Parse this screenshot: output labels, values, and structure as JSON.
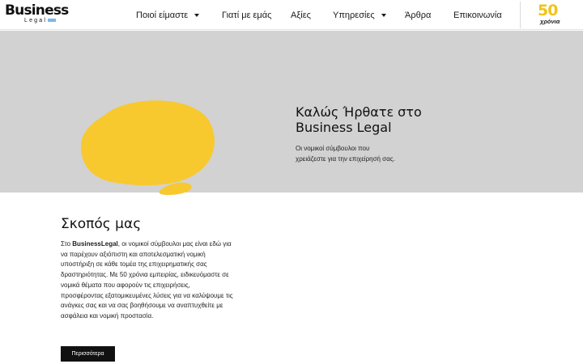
{
  "brand": {
    "logo_word": "Business",
    "logo_sub": "Legal"
  },
  "nav": {
    "items": [
      {
        "label": "Ποιοί είμαστε",
        "has_dropdown": true
      },
      {
        "label": "Γιατί με εμάς",
        "has_dropdown": false
      },
      {
        "label": "Αξίες",
        "has_dropdown": false
      },
      {
        "label": "Υπηρεσίες",
        "has_dropdown": true
      },
      {
        "label": "Άρθρα",
        "has_dropdown": false
      },
      {
        "label": "Επικοινωνία",
        "has_dropdown": false
      }
    ]
  },
  "badge": {
    "number": "50",
    "text": "χρόνια"
  },
  "hero": {
    "title": "Καλώς Ήρθατε στο Business Legal",
    "subtitle": "Οι νομικοί σύμβουλοι που χρειάζεστε για την επιχείρησή σας.",
    "bg_color": "#d2d2d2",
    "blob_color": "#f7c92f"
  },
  "purpose": {
    "title": "Σκοπός μας",
    "body_prefix": "Στο ",
    "body_brand": "BusinessLegal",
    "body_rest": ", οι νομικοί σύμβουλοι μας είναι εδώ για να παρέχουν αξιόπιστη και αποτελεσματική νομική υποστήριξη σε κάθε τομέα της επιχειρηματικής σας δραστηριότητας. Με 50 χρόνια εμπειρίας, ειδικευόμαστε σε νομικά θέματα που αφορούν τις επιχειρήσεις, προσφέροντας εξατομικευμένες λύσεις για να καλύψουμε τις ανάγκες σας και να σας βοηθήσουμε να αναπτυχθείτε με ασφάλεια και νομική προστασία.",
    "button_label": "Περισσότερα"
  }
}
